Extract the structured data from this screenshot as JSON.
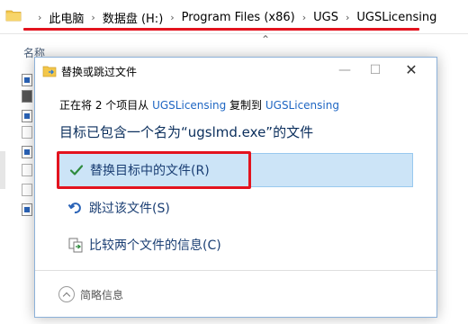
{
  "explorer": {
    "breadcrumbs": [
      "此电脑",
      "数据盘 (H:)",
      "Program Files (x86)",
      "UGS",
      "UGSLicensing"
    ],
    "column_header": "名称"
  },
  "dialog": {
    "title": "替换或跳过文件",
    "sub_prefix": "正在将 2 个项目从 ",
    "source": "UGSLicensing",
    "sub_middle": " 复制到 ",
    "dest": "UGSLicensing",
    "heading": "目标已包含一个名为“ugslmd.exe”的文件",
    "options": {
      "replace": "替换目标中的文件(R)",
      "skip": "跳过该文件(S)",
      "compare": "比较两个文件的信息(C)"
    },
    "details": "简略信息",
    "window_buttons": {
      "minimize": "—",
      "maximize": "☐",
      "close": "✕"
    }
  },
  "colors": {
    "accent": "#1e66c3",
    "highlight_red": "#e3131e",
    "selected_bg": "#cce4f7",
    "check_green": "#2e8b3d"
  }
}
